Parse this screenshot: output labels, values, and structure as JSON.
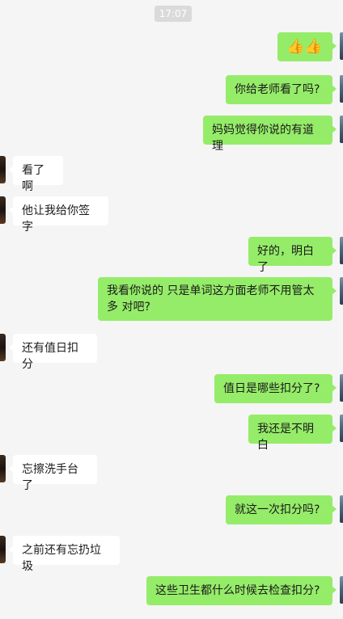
{
  "chat": {
    "timestamp": "17:07",
    "messages": [
      {
        "side": "out",
        "text": "👍👍"
      },
      {
        "side": "out",
        "text": "你给老师看了吗?"
      },
      {
        "side": "out",
        "text": "妈妈觉得你说的有道理"
      },
      {
        "side": "in",
        "text": "看了啊"
      },
      {
        "side": "in",
        "text": "他让我给你签字"
      },
      {
        "side": "out",
        "text": "好的，明白了"
      },
      {
        "side": "out",
        "text": "我看你说的 只是单词这方面老师不用管太多 对吧?"
      },
      {
        "side": "in",
        "text": "还有值日扣分"
      },
      {
        "side": "out",
        "text": "值日是哪些扣分了?"
      },
      {
        "side": "out",
        "text": "我还是不明白"
      },
      {
        "side": "in",
        "text": "忘擦洗手台了"
      },
      {
        "side": "out",
        "text": "就这一次扣分吗?"
      },
      {
        "side": "in",
        "text": "之前还有忘扔垃圾"
      },
      {
        "side": "out",
        "text": "这些卫生都什么时候去检查扣分?"
      }
    ]
  },
  "colors": {
    "outgoing_bubble": "#95ec69",
    "incoming_bubble": "#ffffff",
    "background": "#f5f5f5"
  }
}
